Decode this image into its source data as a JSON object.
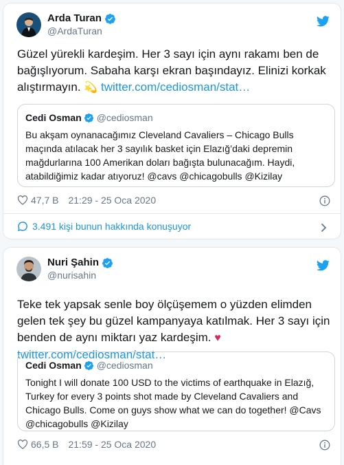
{
  "tweets": [
    {
      "author": {
        "name": "Arda Turan",
        "handle": "@ArdaTuran"
      },
      "text": "Güzel yürekli kardeşim. Her 3 sayı için aynı rakamı ben de bağışlıyorum. Sabaha karşı ekran başındayız. Elinizi korkak alıştırmayın.",
      "emoji": "💫",
      "link": "twitter.com/cediosman/stat…",
      "quote": {
        "name": "Cedi Osman",
        "handle": "@cediosman",
        "text": "Bu akşam oynanacağımız Cleveland Cavaliers – Chicago Bulls maçında atılacak her 3 sayılık basket için Elazığ’daki depremin mağdurlarına 100 Amerikan doları bağışta bulunacağım. Haydi, atabildiğimiz kadar atıyoruz! @cavs @chicagobulls @Kizilay"
      },
      "likes": "47,7 B",
      "timestamp": "21:29 - 25 Oca 2020",
      "conversation": "3.491 kişi bunun hakkında konuşuyor"
    },
    {
      "author": {
        "name": "Nuri Şahin",
        "handle": "@nurisahin"
      },
      "text": "Teke tek yapsak senle boy ölçüşemem o yüzden elimden gelen tek şey bu güzel kampanyaya katılmak. Her 3 sayı için benden de aynı miktarı yaz kardeşim.",
      "emoji": "♥",
      "link": "twitter.com/cediosman/stat…",
      "quote": {
        "name": "Cedi Osman",
        "handle": "@cediosman",
        "text": "Tonight I will donate 100 USD to the victims of earthquake in Elazığ, Turkey for every 3 points shot made by Cleveland Cavaliers and Chicago Bulls. Come on guys show what we can do together! @Cavs @chicagobulls @Kizilay"
      },
      "likes": "66,5 B",
      "timestamp": "21:59 - 25 Oca 2020"
    }
  ],
  "colors": {
    "link": "#1b95e0",
    "verified": "#1da1f2",
    "muted": "#657786",
    "heart_emoji": "#e0245e"
  }
}
